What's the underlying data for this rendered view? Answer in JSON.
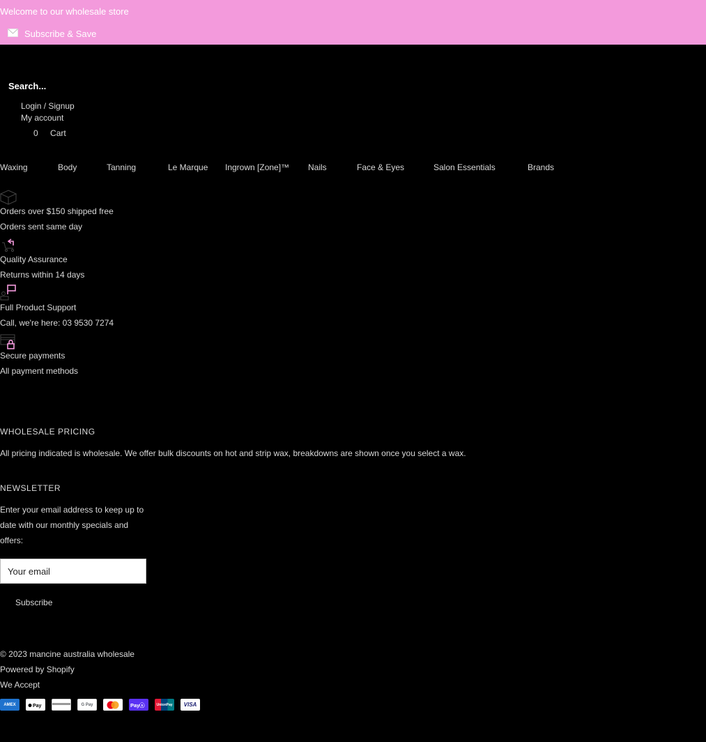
{
  "topbar": {
    "welcome": "Welcome to our wholesale store",
    "subscribe": "Subscribe & Save",
    "bg_color": "#f39adc"
  },
  "header": {
    "search_placeholder": "Search...",
    "login": "Login / Signup",
    "my_account": "My account",
    "cart_count": "0",
    "cart_label": "Cart"
  },
  "nav": {
    "items": [
      "Waxing",
      "Body",
      "Tanning",
      "Le Marque",
      "Ingrown [Zone]™",
      "Nails",
      "Face & Eyes",
      "Salon Essentials",
      "Brands"
    ]
  },
  "features": [
    {
      "icon": "box-icon",
      "title": "Orders over $150 shipped free",
      "subtitle": "Orders sent same day"
    },
    {
      "icon": "cart-return-icon",
      "title": "Quality Assurance",
      "subtitle": "Returns within 14 days"
    },
    {
      "icon": "support-icon",
      "title": "Full Product Support",
      "subtitle": "Call, we're here: 03 9530 7274"
    },
    {
      "icon": "secure-payment-icon",
      "title": "Secure payments",
      "subtitle": "All payment methods"
    }
  ],
  "wholesale": {
    "title": "WHOLESALE PRICING",
    "text": "All pricing indicated is wholesale. We offer bulk discounts on hot and strip wax, breakdowns are shown once you select a wax."
  },
  "newsletter": {
    "title": "NEWSLETTER",
    "text_line1": "Enter your email address to keep up to",
    "text_line2": "date with our monthly specials and",
    "text_line3": "offers:",
    "email_placeholder": "Your email",
    "button": "Subscribe"
  },
  "footer": {
    "copyright": "© 2023 mancine australia wholesale",
    "powered": "Powered by Shopify",
    "we_accept": "We Accept",
    "payment_methods": [
      "AMEX",
      "Apple Pay",
      "Diners",
      "G Pay",
      "Mastercard",
      "Shop Pay",
      "UnionPay",
      "VISA"
    ]
  },
  "colors": {
    "accent_pink": "#f39adc",
    "background": "#000000"
  }
}
